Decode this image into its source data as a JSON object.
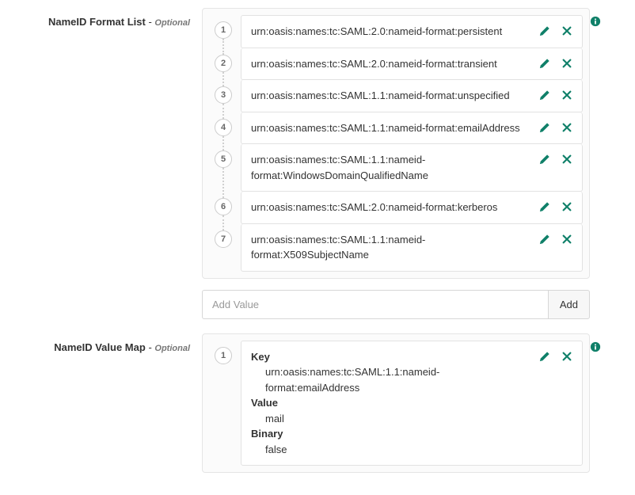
{
  "colors": {
    "action": "#108069"
  },
  "sections": {
    "nameid_list": {
      "label": "NameID Format List",
      "optional_suffix": "Optional",
      "items": [
        "urn:oasis:names:tc:SAML:2.0:nameid-format:persistent",
        "urn:oasis:names:tc:SAML:2.0:nameid-format:transient",
        "urn:oasis:names:tc:SAML:1.1:nameid-format:unspecified",
        "urn:oasis:names:tc:SAML:1.1:nameid-format:emailAddress",
        "urn:oasis:names:tc:SAML:1.1:nameid-format:WindowsDomainQualifiedName",
        "urn:oasis:names:tc:SAML:2.0:nameid-format:kerberos",
        "urn:oasis:names:tc:SAML:1.1:nameid-format:X509SubjectName"
      ],
      "add": {
        "placeholder": "Add Value",
        "button": "Add"
      }
    },
    "nameid_map": {
      "label": "NameID Value Map",
      "optional_suffix": "Optional",
      "items": [
        {
          "key_label": "Key",
          "key": "urn:oasis:names:tc:SAML:1.1:nameid-format:emailAddress",
          "value_label": "Value",
          "value": "mail",
          "binary_label": "Binary",
          "binary": "false"
        }
      ]
    }
  }
}
